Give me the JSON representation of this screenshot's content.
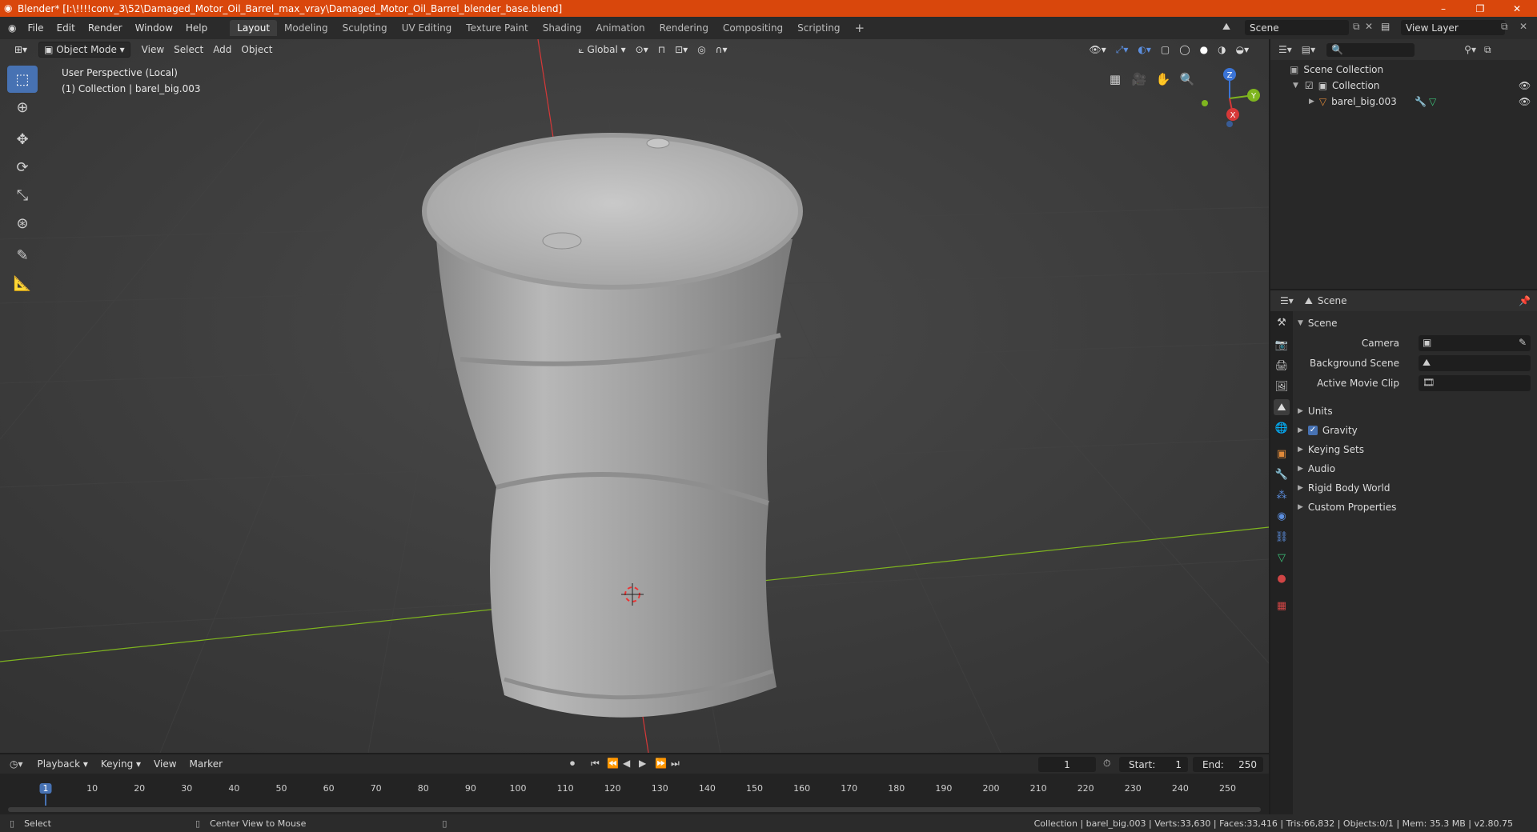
{
  "window": {
    "title": "Blender* [I:\\!!!!conv_3\\52\\Damaged_Motor_Oil_Barrel_max_vray\\Damaged_Motor_Oil_Barrel_blender_base.blend]",
    "minimize": "–",
    "maximize": "❐",
    "close": "✕"
  },
  "menu": [
    "File",
    "Edit",
    "Render",
    "Window",
    "Help"
  ],
  "workspaces": [
    "Layout",
    "Modeling",
    "Sculpting",
    "UV Editing",
    "Texture Paint",
    "Shading",
    "Animation",
    "Rendering",
    "Compositing",
    "Scripting"
  ],
  "active_workspace": "Layout",
  "scene_field": "Scene",
  "view_layer_field": "View Layer",
  "viewport": {
    "mode": "Object Mode",
    "menus": [
      "View",
      "Select",
      "Add",
      "Object"
    ],
    "transform_orientation": "Global",
    "info_line1": "User Perspective (Local)",
    "info_line2": "(1) Collection | barel_big.003",
    "gizmo": {
      "x": "X",
      "y": "Y",
      "z": "Z"
    }
  },
  "outliner": {
    "root": "Scene Collection",
    "collection": "Collection",
    "object": "barel_big.003"
  },
  "properties": {
    "context": "Scene",
    "panel_title": "Scene",
    "fields": [
      {
        "label": "Camera"
      },
      {
        "label": "Background Scene"
      },
      {
        "label": "Active Movie Clip"
      }
    ],
    "sections": [
      "Units",
      "Gravity",
      "Keying Sets",
      "Audio",
      "Rigid Body World",
      "Custom Properties"
    ],
    "gravity_checked": true
  },
  "timeline": {
    "menus": [
      "Playback",
      "Keying",
      "View",
      "Marker"
    ],
    "current_frame": "1",
    "start_label": "Start:",
    "start": "1",
    "end_label": "End:",
    "end": "250",
    "ticks": [
      "1",
      "10",
      "20",
      "30",
      "40",
      "50",
      "60",
      "70",
      "80",
      "90",
      "100",
      "110",
      "120",
      "130",
      "140",
      "150",
      "160",
      "170",
      "180",
      "190",
      "200",
      "210",
      "220",
      "230",
      "240",
      "250"
    ]
  },
  "statusbar": {
    "left": "Select",
    "middle": "Center View to Mouse",
    "right": "Collection | barel_big.003 | Verts:33,630 | Faces:33,416 | Tris:66,832 | Objects:0/1 | Mem: 35.3 MB | v2.80.75"
  },
  "colors": {
    "title_bar": "#d9470c",
    "accent": "#4772b3",
    "x_axis": "#d63838",
    "y_axis": "#7fb51f",
    "z_axis": "#3b74d6"
  }
}
